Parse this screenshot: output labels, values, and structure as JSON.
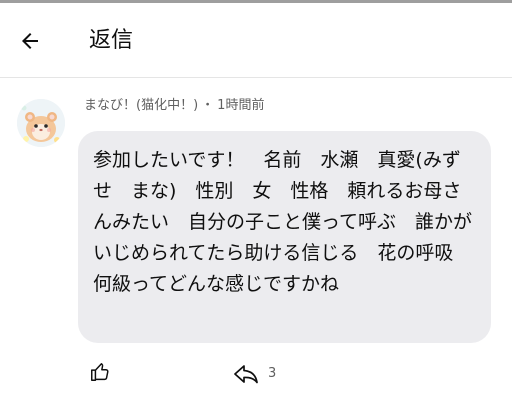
{
  "header": {
    "title": "返信",
    "back_icon": "arrow-left-icon"
  },
  "comment": {
    "author": "まなび！(猫化中！)",
    "separator": "・",
    "time": "1時間前",
    "avatar_icon": "hamster-avatar",
    "text": "参加したいです！　名前　水瀬　真愛(みずせ　まな)　性別　女　性格　頼れるお母さんみたい　自分の子こと僕って呼ぶ　誰かがいじめられてたら助ける信じる　花の呼吸　何級ってどんな感じですかね"
  },
  "actions": {
    "like_icon": "thumbs-up-icon",
    "reply_icon": "reply-icon",
    "reply_count": "3"
  },
  "colors": {
    "bubble": "#ececef",
    "meta_text": "#606060",
    "divider": "#e5e5e5"
  }
}
